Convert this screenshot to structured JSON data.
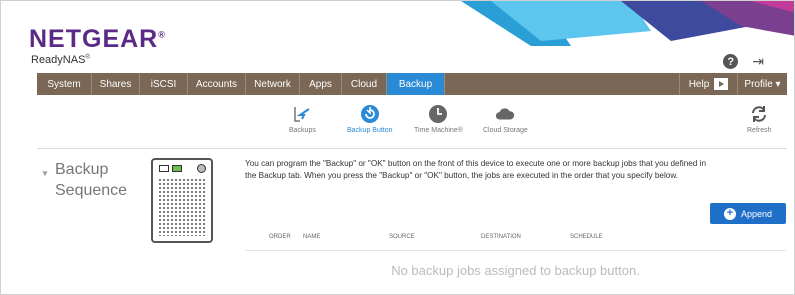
{
  "brand": {
    "logo": "NETGEAR",
    "registered_mark": "®",
    "product": "ReadyNAS",
    "product_mark": "®",
    "logo_color": "#5b2a86"
  },
  "header_icons": [
    {
      "icon": "help-icon",
      "glyph": "?"
    },
    {
      "icon": "logout-icon",
      "glyph": "⇥"
    }
  ],
  "navbar": {
    "tabs": [
      {
        "label": "System",
        "active": false
      },
      {
        "label": "Shares",
        "active": false
      },
      {
        "label": "iSCSI",
        "active": false
      },
      {
        "label": "Accounts",
        "active": false
      },
      {
        "label": "Network",
        "active": false
      },
      {
        "label": "Apps",
        "active": false
      },
      {
        "label": "Cloud",
        "active": false
      },
      {
        "label": "Backup",
        "active": true
      }
    ],
    "help_label": "Help",
    "profile_label": "Profile ▾",
    "bar_color": "#7a6755",
    "active_color": "#2b8ad6"
  },
  "subnav": {
    "items": [
      {
        "label": "Backups",
        "icon": "backups-icon",
        "active": false
      },
      {
        "label": "Backup Button",
        "icon": "backup-button-icon",
        "active": true
      },
      {
        "label": "Time Machine®",
        "icon": "time-machine-icon",
        "active": false
      },
      {
        "label": "Cloud Storage",
        "icon": "cloud-storage-icon",
        "active": false
      }
    ],
    "refresh_label": "Refresh"
  },
  "section": {
    "title_line1": "Backup",
    "title_line2": "Sequence",
    "description": "You can program the \"Backup\" or \"OK\" button on the front of this device to execute one or more backup jobs that you defined in the Backup tab. When you press the \"Backup\" or \"OK\" button, the jobs are executed in the order that you specify below."
  },
  "append_button": {
    "label": "Append",
    "color": "#1f6fc9"
  },
  "table": {
    "columns": [
      "ORDER",
      "NAME",
      "SOURCE",
      "DESTINATION",
      "SCHEDULE"
    ],
    "empty_message": "No backup jobs assigned to backup button."
  }
}
